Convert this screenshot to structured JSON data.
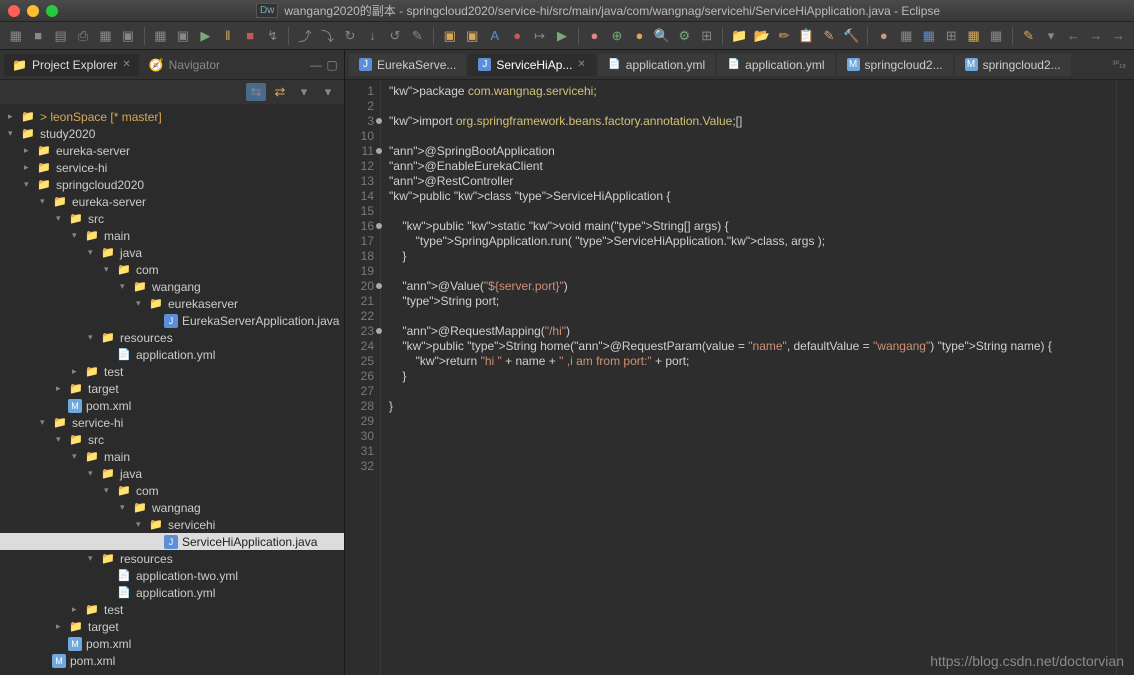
{
  "titlebar": {
    "title": "wangang2020的副本 - springcloud2020/service-hi/src/main/java/com/wangnag/servicehi/ServiceHiApplication.java - Eclipse",
    "badge": "Dw"
  },
  "views": {
    "project_explorer": {
      "label": "Project Explorer",
      "icon": "📁"
    },
    "navigator": {
      "label": "Navigator",
      "icon": "🧭"
    }
  },
  "tree": [
    {
      "d": 0,
      "tw": "▸",
      "i": "📁",
      "l": "> leonSpace [* master]",
      "c": "proj decor",
      "color": "#d9a857"
    },
    {
      "d": 0,
      "tw": "▾",
      "i": "📁",
      "l": "study2020",
      "c": "fold"
    },
    {
      "d": 1,
      "tw": "▸",
      "i": "📁",
      "l": "eureka-server",
      "c": "proj"
    },
    {
      "d": 1,
      "tw": "▸",
      "i": "📁",
      "l": "service-hi",
      "c": "proj"
    },
    {
      "d": 1,
      "tw": "▾",
      "i": "📁",
      "l": "springcloud2020",
      "c": "proj"
    },
    {
      "d": 2,
      "tw": "▾",
      "i": "📁",
      "l": "eureka-server",
      "c": "fold"
    },
    {
      "d": 3,
      "tw": "▾",
      "i": "📁",
      "l": "src",
      "c": "fold"
    },
    {
      "d": 4,
      "tw": "▾",
      "i": "📁",
      "l": "main",
      "c": "fold"
    },
    {
      "d": 5,
      "tw": "▾",
      "i": "📁",
      "l": "java",
      "c": "fold"
    },
    {
      "d": 6,
      "tw": "▾",
      "i": "📁",
      "l": "com",
      "c": "fold"
    },
    {
      "d": 7,
      "tw": "▾",
      "i": "📁",
      "l": "wangang",
      "c": "fold"
    },
    {
      "d": 8,
      "tw": "▾",
      "i": "📁",
      "l": "eurekaserver",
      "c": "fold"
    },
    {
      "d": 9,
      "tw": "",
      "i": "J",
      "l": "EurekaServerApplication.java",
      "c": "java"
    },
    {
      "d": 5,
      "tw": "▾",
      "i": "📁",
      "l": "resources",
      "c": "fold"
    },
    {
      "d": 6,
      "tw": "",
      "i": "📄",
      "l": "application.yml",
      "c": "yml"
    },
    {
      "d": 4,
      "tw": "▸",
      "i": "📁",
      "l": "test",
      "c": "fold"
    },
    {
      "d": 3,
      "tw": "▸",
      "i": "📁",
      "l": "target",
      "c": "fold"
    },
    {
      "d": 3,
      "tw": "",
      "i": "M",
      "l": "pom.xml",
      "c": "xml"
    },
    {
      "d": 2,
      "tw": "▾",
      "i": "📁",
      "l": "service-hi",
      "c": "fold"
    },
    {
      "d": 3,
      "tw": "▾",
      "i": "📁",
      "l": "src",
      "c": "fold"
    },
    {
      "d": 4,
      "tw": "▾",
      "i": "📁",
      "l": "main",
      "c": "fold"
    },
    {
      "d": 5,
      "tw": "▾",
      "i": "📁",
      "l": "java",
      "c": "fold"
    },
    {
      "d": 6,
      "tw": "▾",
      "i": "📁",
      "l": "com",
      "c": "fold"
    },
    {
      "d": 7,
      "tw": "▾",
      "i": "📁",
      "l": "wangnag",
      "c": "fold"
    },
    {
      "d": 8,
      "tw": "▾",
      "i": "📁",
      "l": "servicehi",
      "c": "fold"
    },
    {
      "d": 9,
      "tw": "",
      "i": "J",
      "l": "ServiceHiApplication.java",
      "c": "java",
      "sel": true
    },
    {
      "d": 5,
      "tw": "▾",
      "i": "📁",
      "l": "resources",
      "c": "fold"
    },
    {
      "d": 6,
      "tw": "",
      "i": "📄",
      "l": "application-two.yml",
      "c": "yml"
    },
    {
      "d": 6,
      "tw": "",
      "i": "📄",
      "l": "application.yml",
      "c": "yml"
    },
    {
      "d": 4,
      "tw": "▸",
      "i": "📁",
      "l": "test",
      "c": "fold"
    },
    {
      "d": 3,
      "tw": "▸",
      "i": "📁",
      "l": "target",
      "c": "fold"
    },
    {
      "d": 3,
      "tw": "",
      "i": "M",
      "l": "pom.xml",
      "c": "xml"
    },
    {
      "d": 2,
      "tw": "",
      "i": "M",
      "l": "pom.xml",
      "c": "xml"
    }
  ],
  "editor_tabs": [
    {
      "l": "EurekaServe...",
      "i": "J",
      "active": false
    },
    {
      "l": "ServiceHiAp...",
      "i": "J",
      "active": true,
      "close": true
    },
    {
      "l": "application.yml",
      "i": "📄",
      "active": false
    },
    {
      "l": "application.yml",
      "i": "📄",
      "active": false
    },
    {
      "l": "springcloud2...",
      "i": "M",
      "active": false
    },
    {
      "l": "springcloud2...",
      "i": "M",
      "active": false
    }
  ],
  "tab_right": "³⁰₁₈",
  "code": {
    "1": "package com.wangnag.servicehi;",
    "2": "",
    "3": "import org.springframework.beans.factory.annotation.Value;[]",
    "10": "",
    "11": "@SpringBootApplication",
    "12": "@EnableEurekaClient",
    "13": "@RestController",
    "14": "public class ServiceHiApplication {",
    "15": "",
    "16": "    public static void main(String[] args) {",
    "17": "        SpringApplication.run( ServiceHiApplication.class, args );",
    "18": "    }",
    "19": "",
    "20": "    @Value(\"${server.port}\")",
    "21": "    String port;",
    "22": "",
    "23": "    @RequestMapping(\"/hi\")",
    "24": "    public String home(@RequestParam(value = \"name\", defaultValue = \"wangang\") String name) {",
    "25": "        return \"hi \" + name + \" ,i am from port:\" + port;",
    "26": "    }",
    "27": "",
    "28": "}",
    "29": "",
    "30": "",
    "31": "",
    "32": ""
  },
  "line_numbers": [
    1,
    2,
    3,
    10,
    11,
    12,
    13,
    14,
    15,
    16,
    17,
    18,
    19,
    20,
    21,
    22,
    23,
    24,
    25,
    26,
    27,
    28,
    29,
    30,
    31,
    32
  ],
  "line_marks": {
    "3": true,
    "11": true,
    "16": true,
    "20": true,
    "23": true
  },
  "watermark": "https://blog.csdn.net/doctorvian",
  "toolbar_icons": [
    "▦",
    "■",
    "▤",
    "⎙",
    "▦",
    "▣",
    "▦",
    "▣",
    "▶",
    "‖",
    "■",
    "↯",
    "⤴",
    "⤵",
    "↻",
    "↓",
    "↺",
    "✎",
    "▣",
    "▣",
    "A",
    "●",
    "↦",
    "▶",
    "●",
    "⊕",
    "●",
    "🔍",
    "⚙",
    "⊞",
    "📁",
    "📂",
    "✏",
    "📋",
    "✎",
    "🔨",
    "●",
    "▦",
    "▦",
    "⊞",
    "▦",
    "▦",
    "✎",
    "▾",
    "←",
    "→",
    "→"
  ],
  "colors": {
    "accent_green": "#7ab87a",
    "accent_orange": "#d9a857",
    "editor_bg": "#2d2d2d"
  }
}
